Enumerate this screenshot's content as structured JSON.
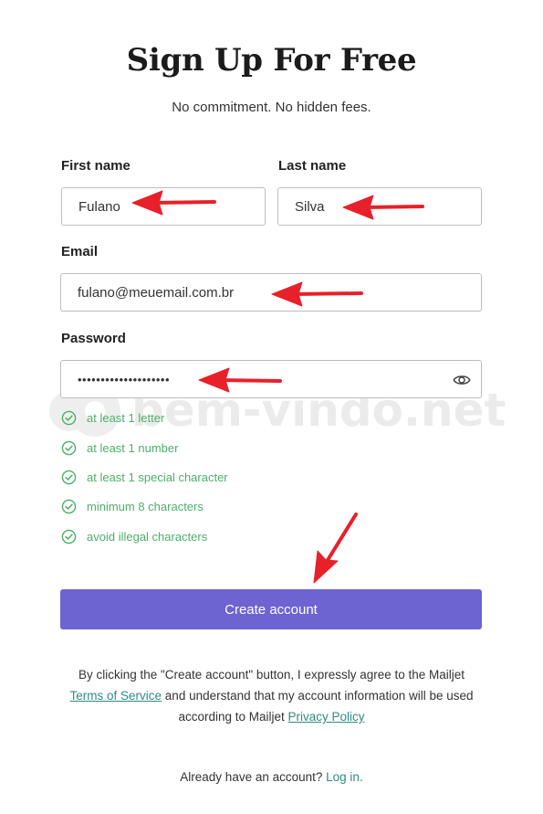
{
  "header": {
    "title": "Sign Up For Free",
    "subtitle": "No commitment. No hidden fees."
  },
  "form": {
    "first_name": {
      "label": "First name",
      "value": "Fulano"
    },
    "last_name": {
      "label": "Last name",
      "value": "Silva"
    },
    "email": {
      "label": "Email",
      "value": "fulano@meuemail.com.br"
    },
    "password": {
      "label": "Password",
      "masked_value": "••••••••••••••••••••",
      "toggle_icon": "eye-icon"
    }
  },
  "password_rules": [
    {
      "text": "at least 1 letter",
      "icon": "check-circle-icon"
    },
    {
      "text": "at least 1 number",
      "icon": "check-circle-icon"
    },
    {
      "text": "at least 1 special character",
      "icon": "check-circle-icon"
    },
    {
      "text": "minimum 8 characters",
      "icon": "check-circle-icon"
    },
    {
      "text": "avoid illegal characters",
      "icon": "check-circle-icon"
    }
  ],
  "submit": {
    "label": "Create account"
  },
  "legal": {
    "part1": "By clicking the \"Create account\" button, I expressly agree to the Mailjet",
    "terms_link": "Terms of Service",
    "part2": "and understand that my account information will be used according to Mailjet",
    "privacy_link": "Privacy Policy"
  },
  "footer": {
    "prompt": "Already have an account?",
    "login_link": "Log in."
  },
  "watermark": {
    "text": "bem-vindo.net"
  },
  "colors": {
    "accent": "#6d64d2",
    "success": "#4caf6a",
    "link": "#2e8c84",
    "annotation_arrow": "#e8202a",
    "watermark": "#e9e9e9"
  }
}
